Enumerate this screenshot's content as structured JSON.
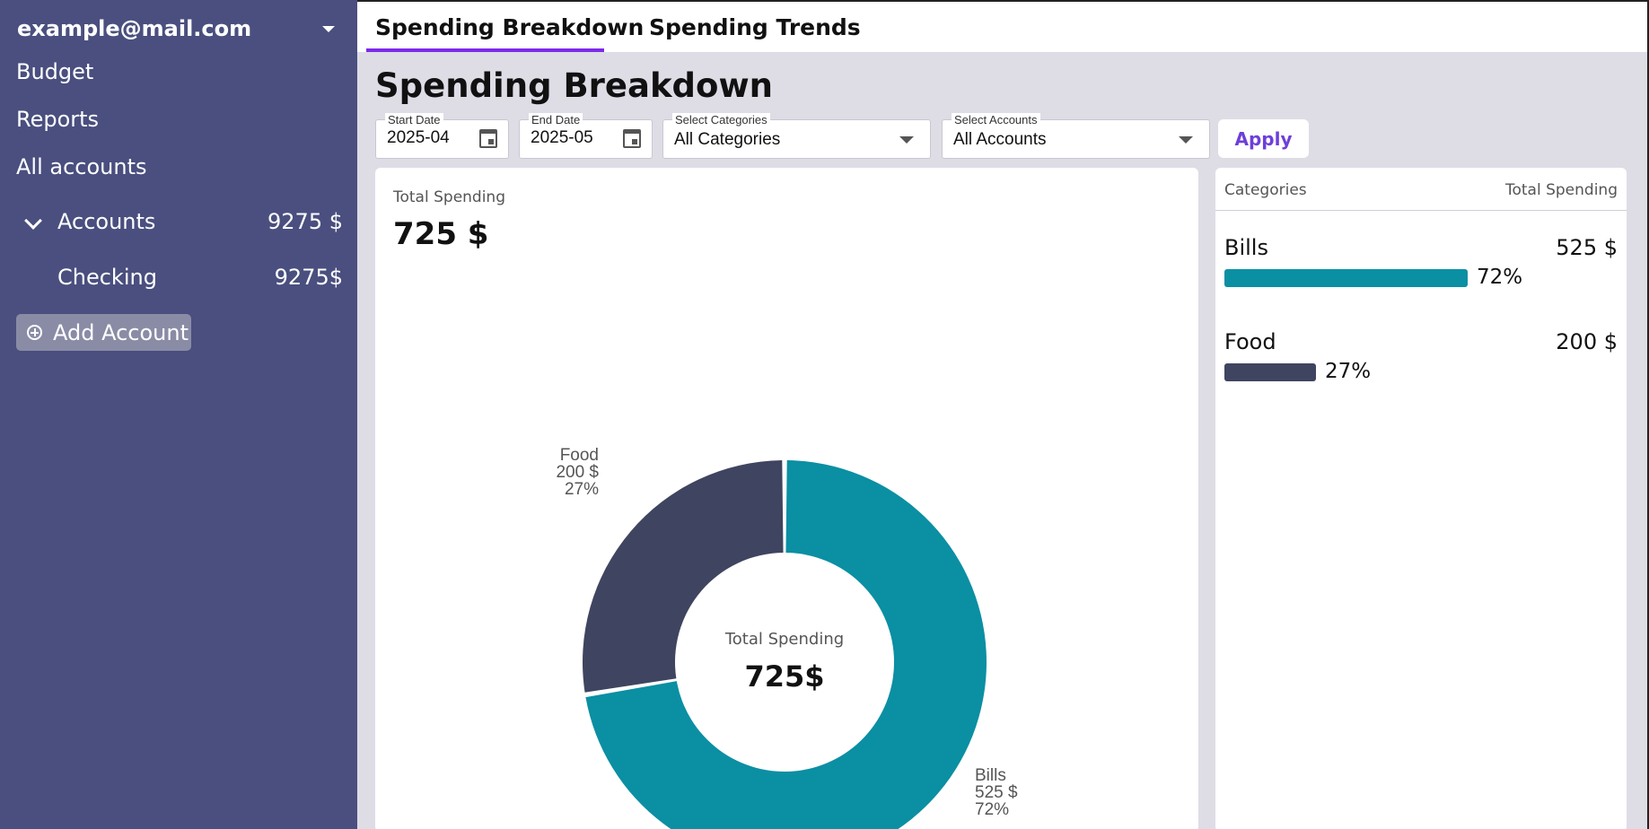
{
  "sidebar": {
    "user_email": "example@mail.com",
    "links": [
      "Budget",
      "Reports",
      "All accounts"
    ],
    "accounts_group": {
      "label": "Accounts",
      "amount": "9275 $"
    },
    "accounts": [
      {
        "label": "Checking",
        "amount": "9275$"
      }
    ],
    "add_account_label": "Add Account"
  },
  "tabs": [
    {
      "label": "Spending Breakdown",
      "active": true
    },
    {
      "label": "Spending Trends",
      "active": false
    }
  ],
  "page_title": "Spending Breakdown",
  "filters": {
    "start_date": {
      "label": "Start Date",
      "value": "2025-04"
    },
    "end_date": {
      "label": "End Date",
      "value": "2025-05"
    },
    "categories": {
      "label": "Select Categories",
      "value": "All Categories"
    },
    "accounts": {
      "label": "Select Accounts",
      "value": "All Accounts"
    },
    "apply_label": "Apply"
  },
  "summary": {
    "total_label": "Total Spending",
    "total_value": "725 $",
    "center_label": "Total Spending",
    "center_value": "725$"
  },
  "category_table": {
    "col_categories": "Categories",
    "col_total": "Total Spending",
    "rows": [
      {
        "name": "Bills",
        "amount": "525 $",
        "percent": "72%",
        "fraction": 0.72,
        "color": "#0b8fa3"
      },
      {
        "name": "Food",
        "amount": "200 $",
        "percent": "27%",
        "fraction": 0.27,
        "color": "#3f4460"
      }
    ]
  },
  "colors": {
    "sidebar": "#4a4f7f",
    "accent": "#7d2ae8",
    "bills": "#0b8fa3",
    "food": "#3f4460",
    "content_bg": "#dedde6"
  },
  "chart_data": {
    "type": "pie",
    "donut": true,
    "categories": [
      "Bills",
      "Food"
    ],
    "values": [
      525,
      200
    ],
    "labels": [
      [
        "Bills",
        "525 $",
        "72%"
      ],
      [
        "Food",
        "200 $",
        "27%"
      ]
    ],
    "colors": [
      "#0b8fa3",
      "#3f4460"
    ],
    "center_text": [
      "Total Spending",
      "725$"
    ]
  }
}
